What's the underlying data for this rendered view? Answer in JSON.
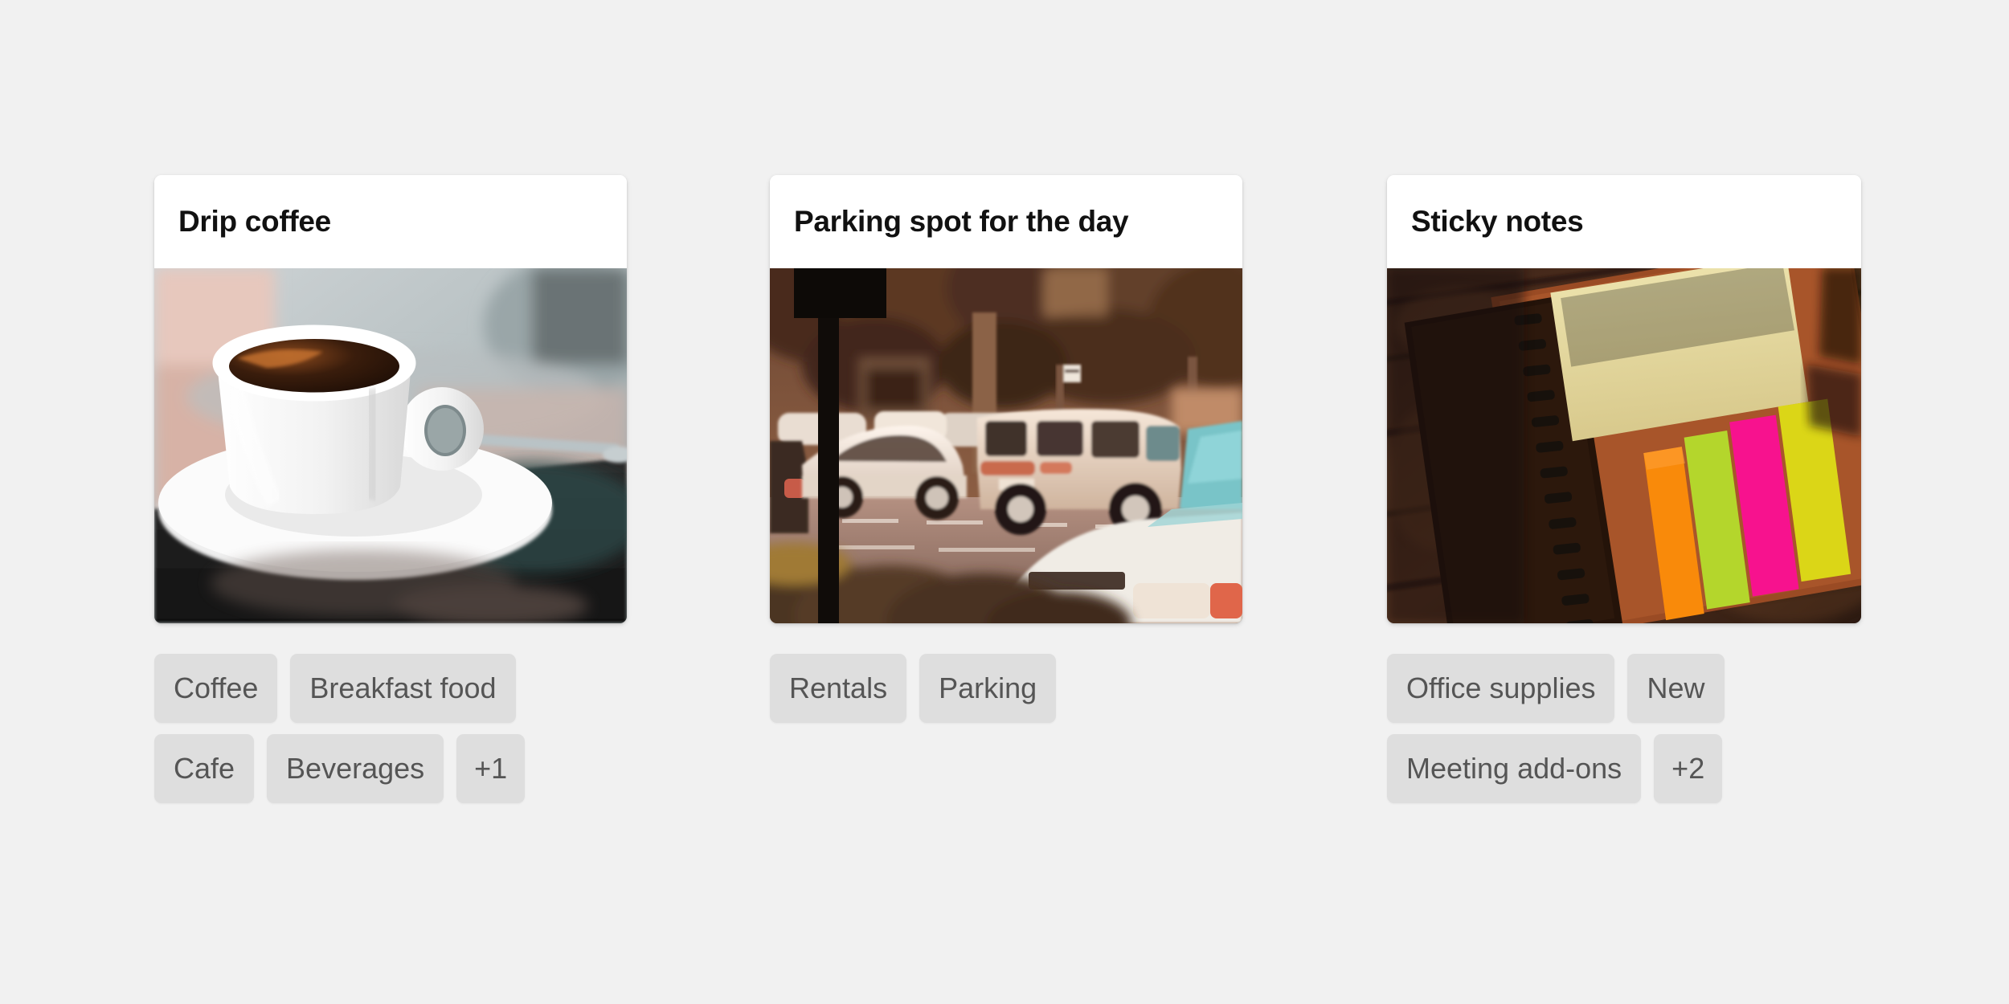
{
  "background_color": "#f1f1f1",
  "chip_color": "#dedede",
  "chip_text_color": "#555555",
  "title_color": "#111111",
  "cards": [
    {
      "title": "Drip coffee",
      "image_name": "coffee-cup-photo",
      "image_alt": "White cup of black drip coffee on a saucer with a spoon on a dark table",
      "tag_rows": [
        [
          "Coffee",
          "Breakfast food"
        ],
        [
          "Cafe",
          "Beverages",
          "+1"
        ]
      ],
      "overflow_label": "+1"
    },
    {
      "title": "Parking spot for the day",
      "image_name": "parking-lot-photo",
      "image_alt": "Sepia toned parking lot with white cars, trees, a sign pole and hedges",
      "tag_rows": [
        [
          "Rentals",
          "Parking"
        ]
      ],
      "overflow_label": ""
    },
    {
      "title": "Sticky notes",
      "image_name": "sticky-notes-photo",
      "image_alt": "Spiral notebook on dark wood with a cream notepad and neon orange, green, pink and yellow sticky flags",
      "tag_rows": [
        [
          "Office supplies",
          "New"
        ],
        [
          "Meeting add-ons",
          "+2"
        ]
      ],
      "overflow_label": "+2"
    }
  ]
}
